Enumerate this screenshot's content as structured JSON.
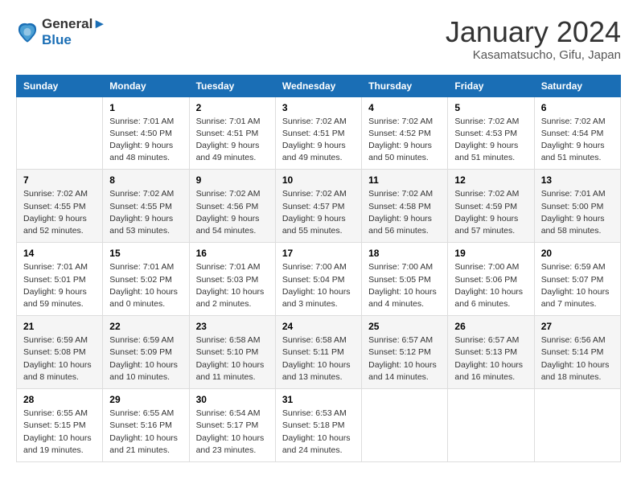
{
  "header": {
    "logo_line1": "General",
    "logo_line2": "Blue",
    "month_title": "January 2024",
    "location": "Kasamatsucho, Gifu, Japan"
  },
  "days_of_week": [
    "Sunday",
    "Monday",
    "Tuesday",
    "Wednesday",
    "Thursday",
    "Friday",
    "Saturday"
  ],
  "weeks": [
    [
      {
        "num": "",
        "info": ""
      },
      {
        "num": "1",
        "info": "Sunrise: 7:01 AM\nSunset: 4:50 PM\nDaylight: 9 hours\nand 48 minutes."
      },
      {
        "num": "2",
        "info": "Sunrise: 7:01 AM\nSunset: 4:51 PM\nDaylight: 9 hours\nand 49 minutes."
      },
      {
        "num": "3",
        "info": "Sunrise: 7:02 AM\nSunset: 4:51 PM\nDaylight: 9 hours\nand 49 minutes."
      },
      {
        "num": "4",
        "info": "Sunrise: 7:02 AM\nSunset: 4:52 PM\nDaylight: 9 hours\nand 50 minutes."
      },
      {
        "num": "5",
        "info": "Sunrise: 7:02 AM\nSunset: 4:53 PM\nDaylight: 9 hours\nand 51 minutes."
      },
      {
        "num": "6",
        "info": "Sunrise: 7:02 AM\nSunset: 4:54 PM\nDaylight: 9 hours\nand 51 minutes."
      }
    ],
    [
      {
        "num": "7",
        "info": "Sunrise: 7:02 AM\nSunset: 4:55 PM\nDaylight: 9 hours\nand 52 minutes."
      },
      {
        "num": "8",
        "info": "Sunrise: 7:02 AM\nSunset: 4:55 PM\nDaylight: 9 hours\nand 53 minutes."
      },
      {
        "num": "9",
        "info": "Sunrise: 7:02 AM\nSunset: 4:56 PM\nDaylight: 9 hours\nand 54 minutes."
      },
      {
        "num": "10",
        "info": "Sunrise: 7:02 AM\nSunset: 4:57 PM\nDaylight: 9 hours\nand 55 minutes."
      },
      {
        "num": "11",
        "info": "Sunrise: 7:02 AM\nSunset: 4:58 PM\nDaylight: 9 hours\nand 56 minutes."
      },
      {
        "num": "12",
        "info": "Sunrise: 7:02 AM\nSunset: 4:59 PM\nDaylight: 9 hours\nand 57 minutes."
      },
      {
        "num": "13",
        "info": "Sunrise: 7:01 AM\nSunset: 5:00 PM\nDaylight: 9 hours\nand 58 minutes."
      }
    ],
    [
      {
        "num": "14",
        "info": "Sunrise: 7:01 AM\nSunset: 5:01 PM\nDaylight: 9 hours\nand 59 minutes."
      },
      {
        "num": "15",
        "info": "Sunrise: 7:01 AM\nSunset: 5:02 PM\nDaylight: 10 hours\nand 0 minutes."
      },
      {
        "num": "16",
        "info": "Sunrise: 7:01 AM\nSunset: 5:03 PM\nDaylight: 10 hours\nand 2 minutes."
      },
      {
        "num": "17",
        "info": "Sunrise: 7:00 AM\nSunset: 5:04 PM\nDaylight: 10 hours\nand 3 minutes."
      },
      {
        "num": "18",
        "info": "Sunrise: 7:00 AM\nSunset: 5:05 PM\nDaylight: 10 hours\nand 4 minutes."
      },
      {
        "num": "19",
        "info": "Sunrise: 7:00 AM\nSunset: 5:06 PM\nDaylight: 10 hours\nand 6 minutes."
      },
      {
        "num": "20",
        "info": "Sunrise: 6:59 AM\nSunset: 5:07 PM\nDaylight: 10 hours\nand 7 minutes."
      }
    ],
    [
      {
        "num": "21",
        "info": "Sunrise: 6:59 AM\nSunset: 5:08 PM\nDaylight: 10 hours\nand 8 minutes."
      },
      {
        "num": "22",
        "info": "Sunrise: 6:59 AM\nSunset: 5:09 PM\nDaylight: 10 hours\nand 10 minutes."
      },
      {
        "num": "23",
        "info": "Sunrise: 6:58 AM\nSunset: 5:10 PM\nDaylight: 10 hours\nand 11 minutes."
      },
      {
        "num": "24",
        "info": "Sunrise: 6:58 AM\nSunset: 5:11 PM\nDaylight: 10 hours\nand 13 minutes."
      },
      {
        "num": "25",
        "info": "Sunrise: 6:57 AM\nSunset: 5:12 PM\nDaylight: 10 hours\nand 14 minutes."
      },
      {
        "num": "26",
        "info": "Sunrise: 6:57 AM\nSunset: 5:13 PM\nDaylight: 10 hours\nand 16 minutes."
      },
      {
        "num": "27",
        "info": "Sunrise: 6:56 AM\nSunset: 5:14 PM\nDaylight: 10 hours\nand 18 minutes."
      }
    ],
    [
      {
        "num": "28",
        "info": "Sunrise: 6:55 AM\nSunset: 5:15 PM\nDaylight: 10 hours\nand 19 minutes."
      },
      {
        "num": "29",
        "info": "Sunrise: 6:55 AM\nSunset: 5:16 PM\nDaylight: 10 hours\nand 21 minutes."
      },
      {
        "num": "30",
        "info": "Sunrise: 6:54 AM\nSunset: 5:17 PM\nDaylight: 10 hours\nand 23 minutes."
      },
      {
        "num": "31",
        "info": "Sunrise: 6:53 AM\nSunset: 5:18 PM\nDaylight: 10 hours\nand 24 minutes."
      },
      {
        "num": "",
        "info": ""
      },
      {
        "num": "",
        "info": ""
      },
      {
        "num": "",
        "info": ""
      }
    ]
  ]
}
